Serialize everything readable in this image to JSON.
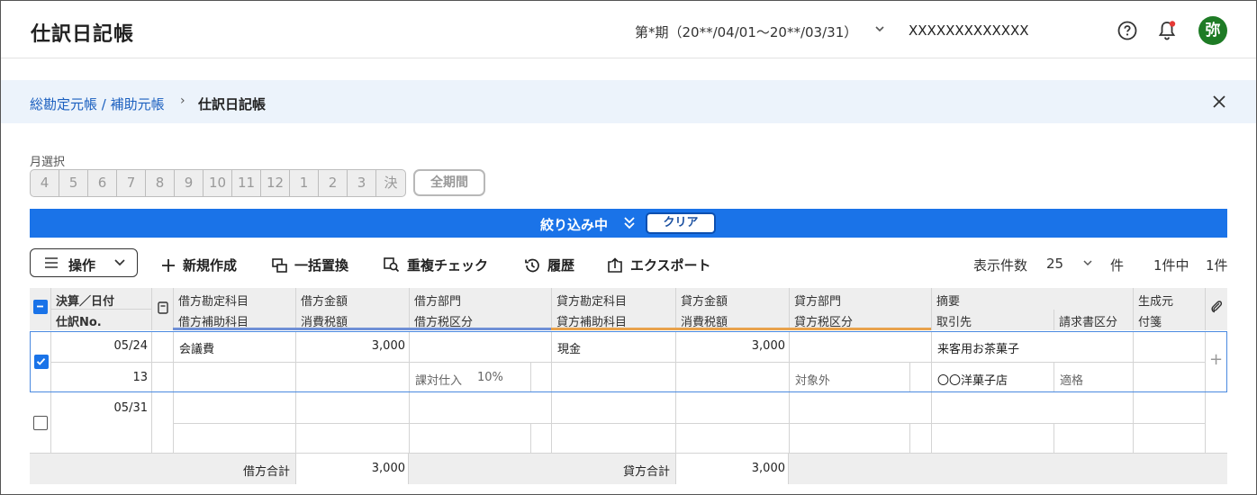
{
  "header": {
    "title": "仕訳日記帳",
    "period": "第*期（20**/04/01〜20**/03/31）",
    "company": "XXXXXXXXXXXXX",
    "avatar": "弥",
    "icons": [
      "help-icon",
      "bell-icon"
    ],
    "notification_dot_color": "#e53935"
  },
  "breadcrumb": {
    "parent": "総勘定元帳 / 補助元帳",
    "separator": "›",
    "current": "仕訳日記帳"
  },
  "month_select": {
    "label": "月選択",
    "months": [
      "4",
      "5",
      "6",
      "7",
      "8",
      "9",
      "10",
      "11",
      "12",
      "1",
      "2",
      "3",
      "決"
    ],
    "all_period": "全期間"
  },
  "filter": {
    "label": "絞り込み中",
    "chevron": "≫",
    "clear": "クリア"
  },
  "toolbar": {
    "ops": "操作",
    "new": "新規作成",
    "replace": "一括置換",
    "duplicate": "重複チェック",
    "history": "履歴",
    "export": "エクスポート",
    "per_page_label": "表示件数",
    "per_page_value": "25",
    "per_page_unit": "件",
    "count_total": "1件中",
    "count_shown": "1件"
  },
  "table": {
    "headers": {
      "date_top": "決算／日付",
      "date_bottom": "仕訳No.",
      "debit_account": "借方勘定科目",
      "debit_sub": "借方補助科目",
      "debit_amount": "借方金額",
      "debit_tax": "消費税額",
      "debit_dept": "借方部門",
      "debit_tax_cat": "借方税区分",
      "credit_account": "貸方勘定科目",
      "credit_sub": "貸方補助科目",
      "credit_amount": "貸方金額",
      "credit_tax": "消費税額",
      "credit_dept": "貸方部門",
      "credit_tax_cat": "貸方税区分",
      "memo": "摘要",
      "partner": "取引先",
      "invoice": "請求書区分",
      "source": "生成元",
      "tag": "付箋"
    },
    "rows": [
      {
        "checked": true,
        "date": "05/24",
        "no": "13",
        "debit_account": "会議費",
        "debit_amount": "3,000",
        "debit_tax_cat": "課対仕入",
        "debit_tax_rate": "10%",
        "credit_account": "現金",
        "credit_amount": "3,000",
        "credit_tax_cat": "対象外",
        "memo": "来客用お茶菓子",
        "partner": "〇〇洋菓子店",
        "invoice": "適格",
        "add": "+"
      },
      {
        "checked": false,
        "date": "05/31",
        "no": ""
      }
    ],
    "totals": {
      "debit_label": "借方合計",
      "debit_value": "3,000",
      "credit_label": "貸方合計",
      "credit_value": "3,000"
    },
    "colors": {
      "debit_underline": "#6f8fd6",
      "credit_underline": "#e8a24c",
      "accent": "#1a73e8"
    }
  }
}
